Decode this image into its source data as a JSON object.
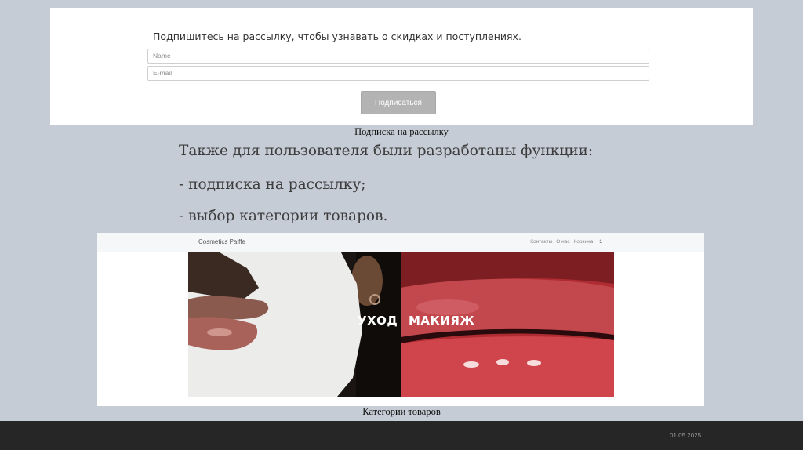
{
  "subscribe_form": {
    "heading": "Подпишитесь на рассылку, чтобы узнавать о скидках и поступлениях.",
    "name_placeholder": "Name",
    "email_placeholder": "E-mail",
    "submit_label": "Подписаться"
  },
  "captions": {
    "subscribe": "Подписка на рассылку",
    "categories": "Категории товаров"
  },
  "body_lines": [
    "Также для пользователя были разработаны функции:",
    "- подписка на рассылку;",
    "- выбор категории товаров."
  ],
  "category_page": {
    "brand": "Cosmetics Palffe",
    "nav": {
      "contacts": "Контакты",
      "about": "О нас",
      "cart": "Корзина",
      "cart_count": "1"
    },
    "tiles": [
      {
        "label": "УХОД"
      },
      {
        "label": "МАКИЯЖ"
      }
    ]
  },
  "footer": {
    "date": "01.05.2025"
  },
  "colors": {
    "slide_background": "#c5ccd5",
    "footer": "#262626",
    "button": "#b3b3b3"
  }
}
